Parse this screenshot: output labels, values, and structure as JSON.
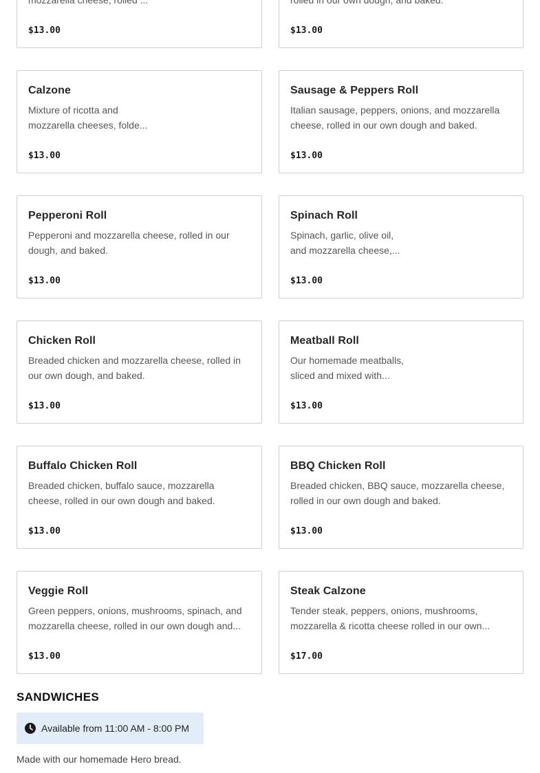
{
  "menu_items": [
    {
      "name": "",
      "description": "mozzarella cheese, rolled ...",
      "price": "$13.00"
    },
    {
      "name": "",
      "description": "rolled in our own dough, and baked.",
      "price": "$13.00"
    },
    {
      "name": "Calzone",
      "description": "Mixture of ricotta and mozzarella cheeses, folde...",
      "price": "$13.00"
    },
    {
      "name": "Sausage & Peppers Roll",
      "description": "Italian sausage, peppers, onions, and mozzarella cheese, rolled in our own dough and baked.",
      "price": "$13.00"
    },
    {
      "name": "Pepperoni Roll",
      "description": "Pepperoni and mozzarella cheese, rolled in our dough, and baked.",
      "price": "$13.00"
    },
    {
      "name": "Spinach Roll",
      "description": "Spinach, garlic, olive oil, and mozzarella cheese,...",
      "price": "$13.00"
    },
    {
      "name": "Chicken Roll",
      "description": "Breaded chicken and mozzarella cheese, rolled in our own dough, and baked.",
      "price": "$13.00"
    },
    {
      "name": "Meatball Roll",
      "description": "Our homemade meatballs, sliced and mixed with...",
      "price": "$13.00"
    },
    {
      "name": "Buffalo Chicken Roll",
      "description": "Breaded chicken, buffalo sauce, mozzarella cheese, rolled in our own dough and baked.",
      "price": "$13.00"
    },
    {
      "name": "BBQ Chicken Roll",
      "description": "Breaded chicken, BBQ sauce, mozzarella cheese, rolled in our own dough and baked.",
      "price": "$13.00"
    },
    {
      "name": "Veggie Roll",
      "description": "Green peppers, onions, mushrooms, spinach, and mozzarella cheese, rolled in our own dough and...",
      "price": "$13.00"
    },
    {
      "name": "Steak Calzone",
      "description": "Tender steak, peppers, onions, mushrooms, mozzarella & ricotta cheese rolled in our own...",
      "price": "$17.00"
    }
  ],
  "sandwiches": {
    "title": "SANDWICHES",
    "availability": "Available from 11:00 AM - 8:00 PM",
    "availability_icon": "clock-icon",
    "description": "Made with our homemade Hero bread."
  },
  "colors": {
    "availability_bg": "#e3edf9",
    "card_border": "#cfcfcf"
  }
}
